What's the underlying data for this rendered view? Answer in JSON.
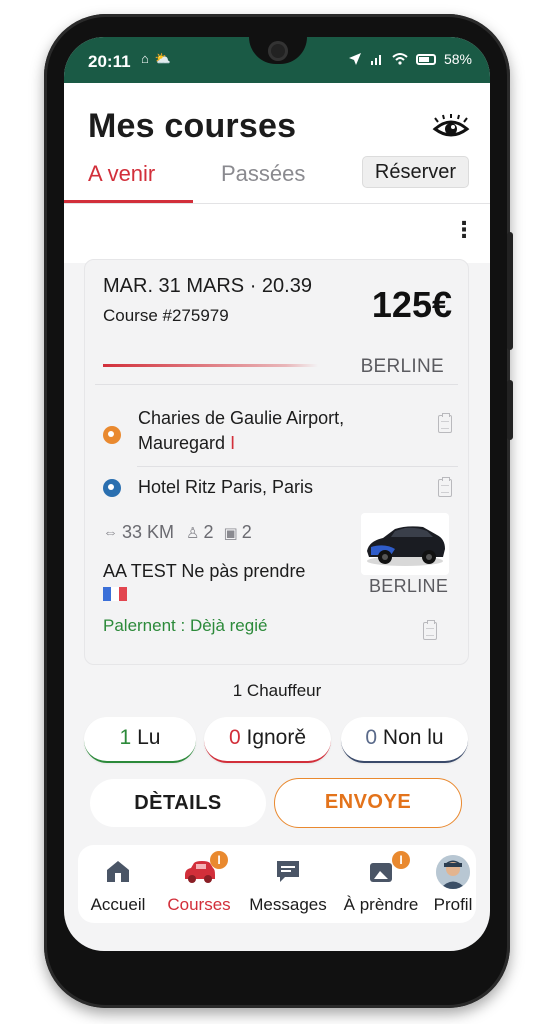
{
  "status_bar": {
    "time": "20:11",
    "left_icons": "⌂ ⛅",
    "battery": "58%"
  },
  "header": {
    "title": "Mes courses",
    "eye_icon": "eye-icon"
  },
  "tabs": [
    {
      "label": "A venir",
      "active": true
    },
    {
      "label": "Passées",
      "active": false
    }
  ],
  "reserve_button": "Réserver",
  "more_icon": "vertical-dots-icon",
  "ride": {
    "date": "MAR. 31 MARS · 20.39",
    "course_number": "Course #275979",
    "price": "125€",
    "vehicle_class": "BERLINE",
    "pickup_line1": "Charies de Gaulie Airport,",
    "pickup_line2": "Mauregard",
    "pickup_accent": "I",
    "destination": "Hotel Ritz Paris, Paris",
    "distance": "33 KM",
    "passengers": "2",
    "luggage": "2",
    "passenger_name": "AA TEST Ne pàs prendre",
    "flag": "FR",
    "vehicle_label": "BERLINE",
    "payment": "Palernent : Dèjà regié",
    "colors": {
      "accent": "#d22f3a",
      "origin": "#e9892f",
      "destination": "#2a6fb0",
      "payment": "#2c8a3a"
    }
  },
  "dispatch": {
    "chauffeur_count": "1 Chauffeur",
    "read": {
      "count": "1",
      "label": "Lu"
    },
    "ignored": {
      "count": "0",
      "label": "Ignorě"
    },
    "unread": {
      "count": "0",
      "label": "Non lu"
    }
  },
  "actions": {
    "details": "DÈTAILS",
    "sent": "ENVOYE"
  },
  "bottom_nav": [
    {
      "label": "Accueil",
      "icon": "home-icon",
      "badge": ""
    },
    {
      "label": "Courses",
      "icon": "car-icon",
      "badge": "I",
      "active": true
    },
    {
      "label": "Messages",
      "icon": "message-icon",
      "badge": ""
    },
    {
      "label": "À prèndre",
      "icon": "take-icon",
      "badge": "I"
    },
    {
      "label": "Profil",
      "icon": "avatar",
      "badge": ""
    }
  ]
}
